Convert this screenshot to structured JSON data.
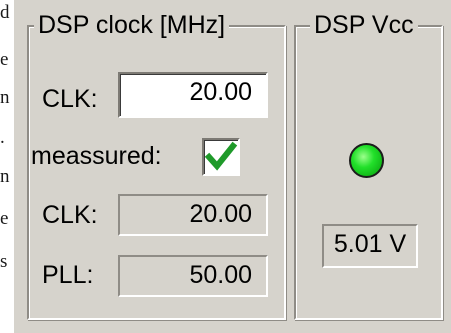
{
  "left_strip_letters": [
    "d",
    "e",
    "n",
    ".",
    "n",
    "e",
    "s"
  ],
  "clock_group": {
    "title": "DSP clock [MHz]",
    "clk_label": "CLK:",
    "clk_value": "20.00",
    "measured_label": "meassured:",
    "measured_checked": true,
    "measured_clk_label": "CLK:",
    "measured_clk_value": "20.00",
    "pll_label": "PLL:",
    "pll_value": "50.00"
  },
  "vcc_group": {
    "title": "DSP Vcc",
    "led_color": "#22e02a",
    "led_state": "on",
    "voltage": "5.01 V"
  },
  "colors": {
    "panel_bg": "#d6d3cc",
    "check_color": "#1f9a2a"
  }
}
